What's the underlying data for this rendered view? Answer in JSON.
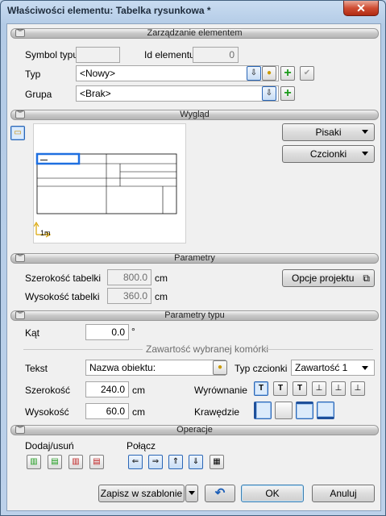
{
  "window": {
    "title": "Właściwości elementu: Tabelka rysunkowa *",
    "close_symbol": "✕"
  },
  "sections": {
    "element_management": "Zarządzanie elementem",
    "appearance": "Wygląd",
    "parameters": "Parametry",
    "type_parameters": "Parametry typu",
    "operations": "Operacje"
  },
  "management": {
    "symbol_label": "Symbol typu",
    "symbol_value": "",
    "element_id_label": "Id elementu",
    "element_id_value": "0",
    "type_label": "Typ",
    "type_value": "<Nowy>",
    "group_label": "Grupa",
    "group_value": "<Brak>"
  },
  "appearance": {
    "pens_button": "Pisaki",
    "fonts_button": "Czcionki",
    "scale_label": "1m"
  },
  "parameters": {
    "width_label": "Szerokość tabelki",
    "width_value": "800.0",
    "width_unit": "cm",
    "height_label": "Wysokość tabelki",
    "height_value": "360.0",
    "height_unit": "cm",
    "project_options_button": "Opcje projektu"
  },
  "type_params": {
    "angle_label": "Kąt",
    "angle_value": "0.0",
    "angle_unit": "°",
    "cell_group_title": "Zawartość wybranej komórki",
    "text_label": "Tekst",
    "text_value": "Nazwa obiektu:",
    "font_type_label": "Typ czcionki",
    "font_type_value": "Zawartość 1",
    "cell_width_label": "Szerokość",
    "cell_width_value": "240.0",
    "cell_width_unit": "cm",
    "cell_height_label": "Wysokość",
    "cell_height_value": "60.0",
    "cell_height_unit": "cm",
    "alignment_label": "Wyrównanie",
    "edges_label": "Krawędzie"
  },
  "operations": {
    "add_remove_label": "Dodaj/usuń",
    "merge_label": "Połącz"
  },
  "footer": {
    "save_template_button": "Zapisz w szablonie",
    "ok_button": "OK",
    "cancel_button": "Anuluj"
  }
}
